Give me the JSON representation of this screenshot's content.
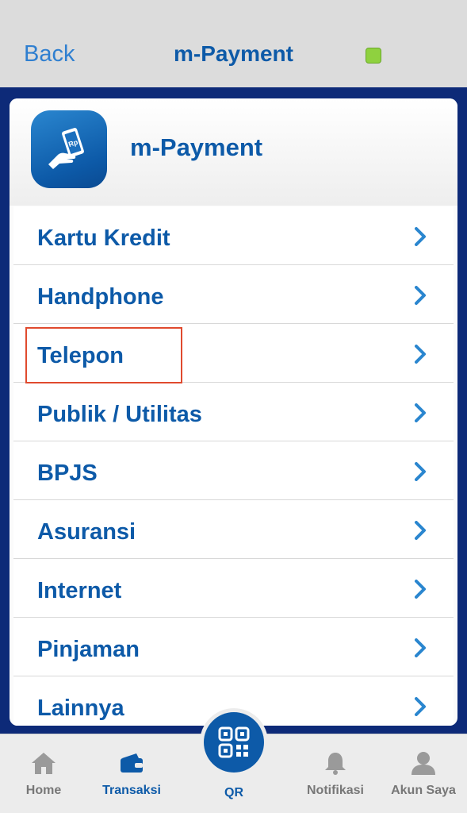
{
  "header": {
    "back_label": "Back",
    "title": "m-Payment"
  },
  "card": {
    "title": "m-Payment"
  },
  "menu": {
    "items": [
      {
        "label": "Kartu Kredit"
      },
      {
        "label": "Handphone"
      },
      {
        "label": "Telepon"
      },
      {
        "label": "Publik / Utilitas"
      },
      {
        "label": "BPJS"
      },
      {
        "label": "Asuransi"
      },
      {
        "label": "Internet"
      },
      {
        "label": "Pinjaman"
      },
      {
        "label": "Lainnya"
      }
    ]
  },
  "bottom_nav": {
    "home": "Home",
    "transaksi": "Transaksi",
    "qr": "QR",
    "notifikasi": "Notifikasi",
    "akun": "Akun Saya"
  },
  "colors": {
    "brand_blue": "#0d5aa8",
    "navy": "#0d2a78",
    "link_blue": "#2f7fd0",
    "status_green": "#8fd13f",
    "highlight_red": "#e04a2e"
  },
  "icons": [
    "chevron-right-icon",
    "home-icon",
    "wallet-icon",
    "qr-icon",
    "bell-icon",
    "user-icon",
    "hand-money-icon"
  ]
}
